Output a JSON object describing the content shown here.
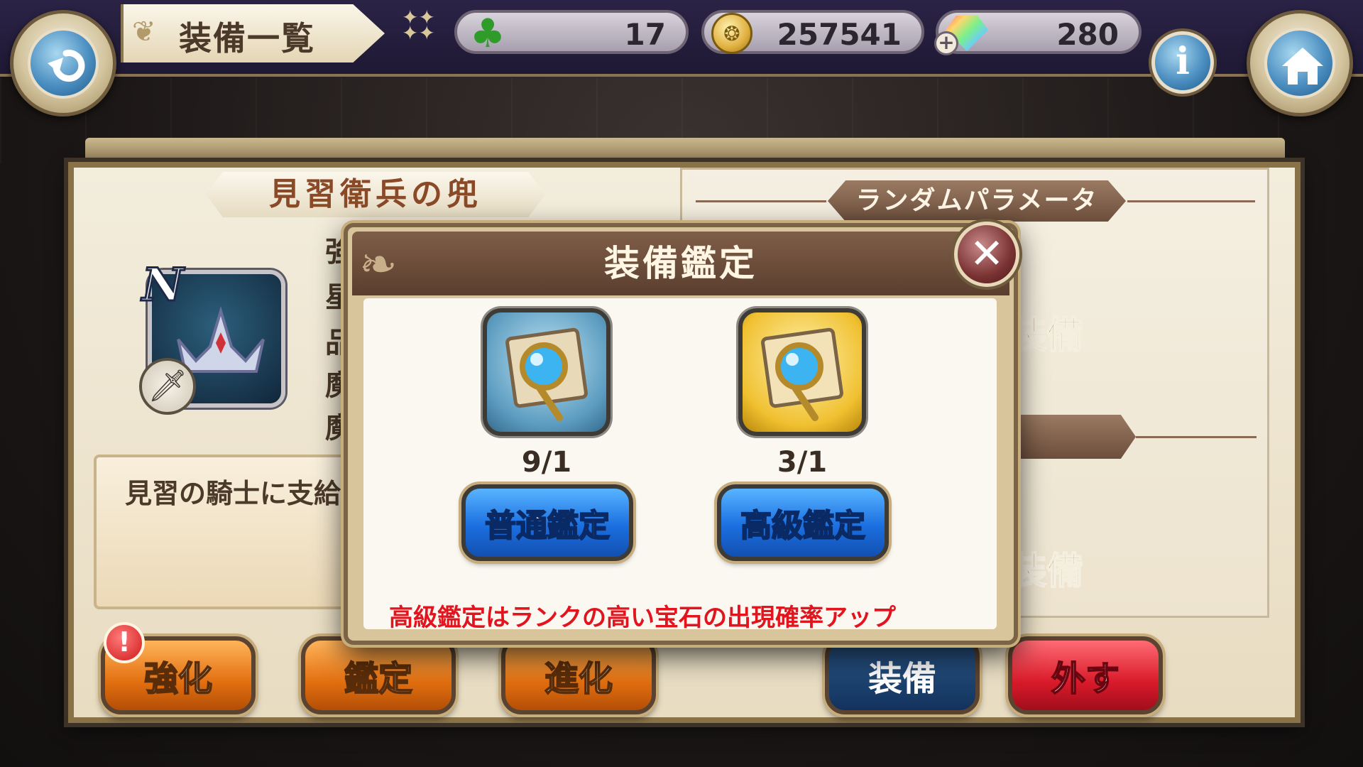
{
  "header": {
    "title": "装備一覧",
    "clover_count": "17",
    "gold_count": "257541",
    "gem_count": "280",
    "plus_label": "+",
    "info_label": "i"
  },
  "item": {
    "name": "見習衛兵の兜",
    "rarity": "N",
    "stat_labels": [
      "強",
      "星",
      "品",
      "魔",
      "魔"
    ],
    "description": "見習の騎士に支給"
  },
  "random_params": {
    "header": "ランダムパラメータ",
    "slot_label_1": "装備",
    "slot_label_2": "装備"
  },
  "actions": {
    "enhance": "強化",
    "appraise": "鑑定",
    "evolve": "進化",
    "equip": "装備",
    "unequip": "外す",
    "alert_mark": "!"
  },
  "modal": {
    "title": "装備鑑定",
    "close_label": "✕",
    "normal_count": "9/1",
    "premium_count": "3/1",
    "normal_button": "普通鑑定",
    "premium_button": "高級鑑定",
    "note": "高級鑑定はランクの高い宝石の出現確率アップ"
  },
  "colors": {
    "note_red": "#e2141e",
    "button_blue": "#1b6fe0",
    "action_orange": "#e26f10",
    "action_red": "#d91a2a",
    "action_navy": "#12325c"
  },
  "icons": {
    "back": "back-arrow-icon",
    "home": "home-icon",
    "info": "info-icon",
    "clover": "clover-icon",
    "gold": "gold-coin-icon",
    "gem": "rainbow-gem-icon",
    "close": "close-icon",
    "helm": "helm-icon",
    "weapon_type": "sword-type-icon",
    "magnifier": "magnifier-scroll-icon"
  }
}
